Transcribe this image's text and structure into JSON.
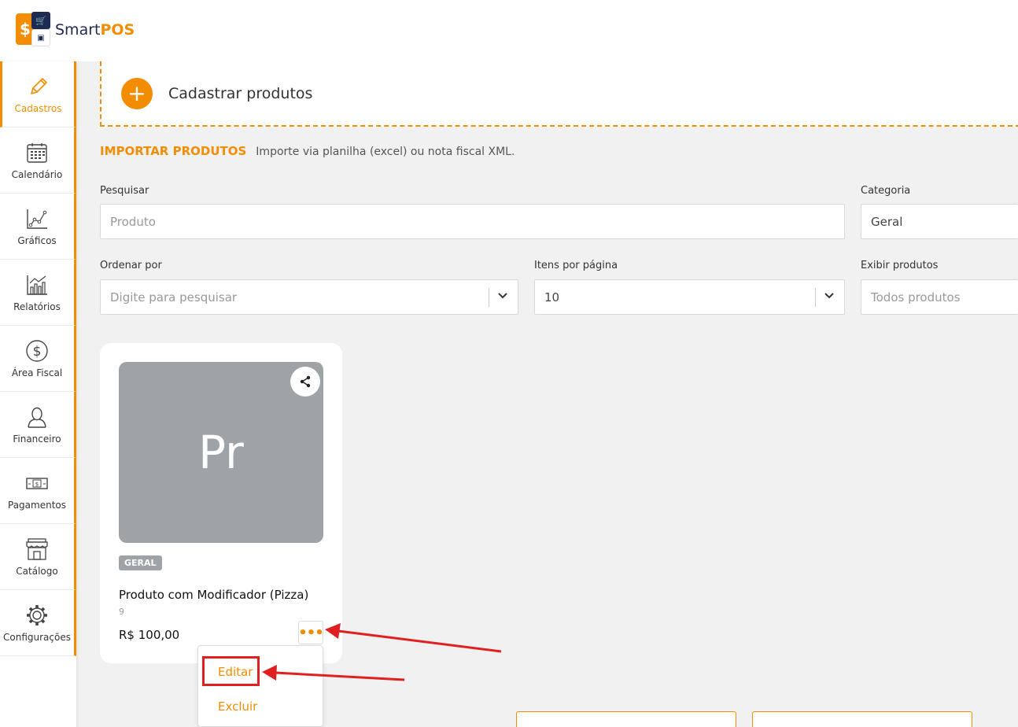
{
  "app": {
    "logo_smart": "Smart",
    "logo_pos": "POS"
  },
  "sidebar": {
    "items": [
      {
        "label": "Cadastros",
        "icon": "pencil-icon",
        "active": true
      },
      {
        "label": "Calendário",
        "icon": "calendar-icon"
      },
      {
        "label": "Gráficos",
        "icon": "line-chart-icon"
      },
      {
        "label": "Relatórios",
        "icon": "bar-chart-icon"
      },
      {
        "label": "Área Fiscal",
        "icon": "dollar-circle-icon"
      },
      {
        "label": "Financeiro",
        "icon": "user-icon"
      },
      {
        "label": "Pagamentos",
        "icon": "banknote-icon"
      },
      {
        "label": "Catálogo",
        "icon": "store-icon"
      },
      {
        "label": "Configurações",
        "icon": "gear-icon"
      }
    ]
  },
  "main": {
    "register_label": "Cadastrar produtos",
    "import_link": "IMPORTAR PRODUTOS",
    "import_desc": "Importe via planilha (excel) ou nota fiscal XML.",
    "filters": {
      "search_label": "Pesquisar",
      "search_placeholder": "Produto",
      "category_label": "Categoria",
      "category_value": "Geral",
      "order_label": "Ordenar por",
      "order_placeholder": "Digite para pesquisar",
      "per_page_label": "Itens por página",
      "per_page_value": "10",
      "show_label": "Exibir produtos",
      "show_value": "Todos produtos"
    }
  },
  "product": {
    "initials": "Pr",
    "category_badge": "GERAL",
    "name": "Produto com Modificador (Pizza)",
    "code": "9",
    "price": "R$ 100,00",
    "more_glyph": "•••"
  },
  "menu": {
    "edit": "Editar",
    "delete": "Excluir"
  },
  "annotation_color": "#e02020",
  "accent_color": "#f28c00"
}
